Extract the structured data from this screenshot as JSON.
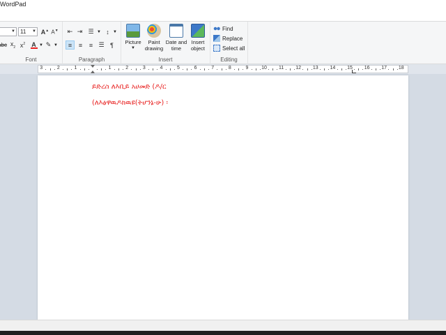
{
  "app": {
    "title": "WordPad"
  },
  "font": {
    "size_value": "11",
    "group_label": "Font"
  },
  "paragraph": {
    "group_label": "Paragraph"
  },
  "insert": {
    "group_label": "Insert",
    "picture": "Picture",
    "paint_1": "Paint",
    "paint_2": "drawing",
    "date_1": "Date and",
    "date_2": "time",
    "object_1": "Insert",
    "object_2": "object"
  },
  "editing": {
    "group_label": "Editing",
    "find": "Find",
    "replace": "Replace",
    "select_all": "Select all"
  },
  "ruler": {
    "labels": [
      "3",
      "2",
      "1",
      "1",
      "2",
      "3",
      "4",
      "5",
      "6",
      "7",
      "8",
      "9",
      "10",
      "11",
      "12",
      "13",
      "14",
      "15",
      "16",
      "17",
      "18"
    ]
  },
  "document": {
    "lines": [
      "ይድረስ ለእቢይ አሀመድ (ዶ/ር",
      "(ለእፅዋዉዶክዉዩ(ትሆንኔ-ሁ) ፡"
    ]
  },
  "colors": {
    "text_color": "#e8201f",
    "accent": "#3c78c8"
  },
  "icons": [
    "bold-icon",
    "subscript-icon",
    "superscript-icon",
    "font-color-icon",
    "highlight-icon",
    "grow-font-icon",
    "shrink-font-icon",
    "decrease-indent-icon",
    "increase-indent-icon",
    "bullets-icon",
    "line-spacing-icon",
    "align-left-icon",
    "align-center-icon",
    "align-right-icon",
    "justify-icon",
    "paragraph-settings-icon",
    "picture-icon",
    "paint-icon",
    "datetime-icon",
    "object-icon",
    "find-icon",
    "replace-icon",
    "select-all-icon"
  ]
}
